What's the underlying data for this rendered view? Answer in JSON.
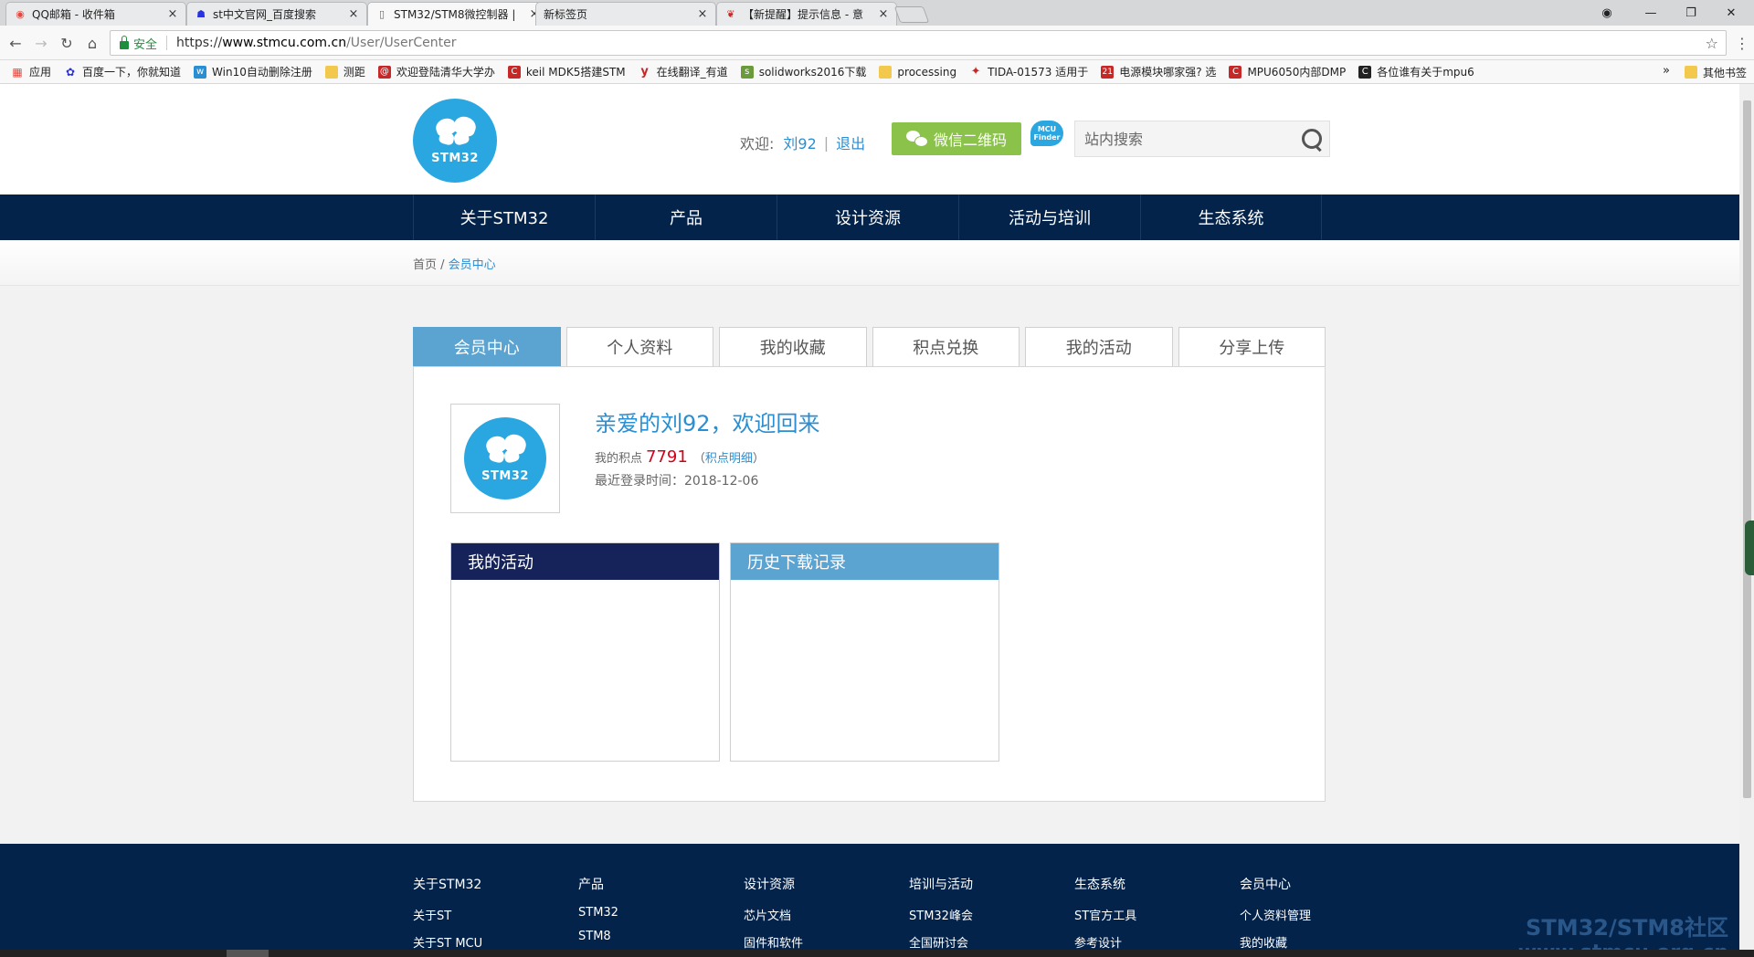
{
  "browser": {
    "tabs": [
      {
        "title": "QQ邮箱 - 收件箱",
        "close": "×"
      },
      {
        "title": "st中文官网_百度搜索",
        "close": "×"
      },
      {
        "title": "STM32/STM8微控制器 |",
        "close": "×"
      },
      {
        "title": "新标签页",
        "close": "×"
      },
      {
        "title": "【新提醒】提示信息 - 意",
        "close": "×"
      }
    ],
    "secure_label": "安全",
    "url_scheme": "https://",
    "url_host": "www.stmcu.com.cn",
    "url_path": "/User/UserCenter",
    "bookmarks": [
      {
        "label": "应用",
        "color": "#e8453c"
      },
      {
        "label": "百度一下，你就知道",
        "color": "#2932e1"
      },
      {
        "label": "Win10自动删除注册",
        "color": "#2a8ed2"
      },
      {
        "label": "测距",
        "color": "#f2c94c"
      },
      {
        "label": "欢迎登陆清华大学办",
        "color": "#c62828"
      },
      {
        "label": "keil MDK5搭建STM",
        "color": "#c62828"
      },
      {
        "label": "在线翻译_有道",
        "color": "#c62828"
      },
      {
        "label": "solidworks2016下载",
        "color": "#6a9a3a"
      },
      {
        "label": "processing",
        "color": "#f2c94c"
      },
      {
        "label": "TIDA-01573 适用于",
        "color": "#c62828"
      },
      {
        "label": "电源模块哪家强? 选",
        "color": "#c62828"
      },
      {
        "label": "MPU6050内部DMP",
        "color": "#c62828"
      },
      {
        "label": "各位谁有关于mpu6",
        "color": "#222222"
      }
    ],
    "bookmarks_more": "»",
    "other_bookmarks": "其他书签"
  },
  "header": {
    "logo_text": "STM32",
    "welcome_label": "欢迎:",
    "username": "刘92",
    "logout": "退出",
    "wechat_button": "微信二维码",
    "mcu_finder": "MCU Finder",
    "search_placeholder": "站内搜索"
  },
  "nav": {
    "items": [
      "关于STM32",
      "产品",
      "设计资源",
      "活动与培训",
      "生态系统"
    ]
  },
  "breadcrumb": {
    "home": "首页",
    "separator": " / ",
    "current": "会员中心"
  },
  "tabs": [
    "会员中心",
    "个人资料",
    "我的收藏",
    "积点兑换",
    "我的活动",
    "分享上传"
  ],
  "profile": {
    "greeting": "亲爱的刘92，欢迎回来",
    "points_label": "我的积点",
    "points_value": "7791",
    "points_link": "积点明细",
    "points_link_open": "（",
    "points_link_close": "）",
    "last_login_label": "最近登录时间：",
    "last_login_value": "2018-12-06"
  },
  "boxes": [
    {
      "title": "我的活动",
      "color": "#16235b"
    },
    {
      "title": "历史下载记录",
      "color": "#5ba3d0"
    }
  ],
  "footer": {
    "columns": [
      {
        "heading": "关于STM32",
        "items": [
          "关于ST",
          "关于ST MCU"
        ]
      },
      {
        "heading": "产品",
        "items": [
          "STM32",
          "STM8"
        ]
      },
      {
        "heading": "设计资源",
        "items": [
          "芯片文档",
          "固件和软件"
        ]
      },
      {
        "heading": "培训与活动",
        "items": [
          "STM32峰会",
          "全国研讨会"
        ]
      },
      {
        "heading": "生态系统",
        "items": [
          "ST官方工具",
          "参考设计"
        ]
      },
      {
        "heading": "会员中心",
        "items": [
          "个人资料管理",
          "我的收藏"
        ]
      }
    ]
  },
  "watermark": {
    "line1": "STM32/STM8社区",
    "line2": "www.stmcu.org.cn"
  }
}
